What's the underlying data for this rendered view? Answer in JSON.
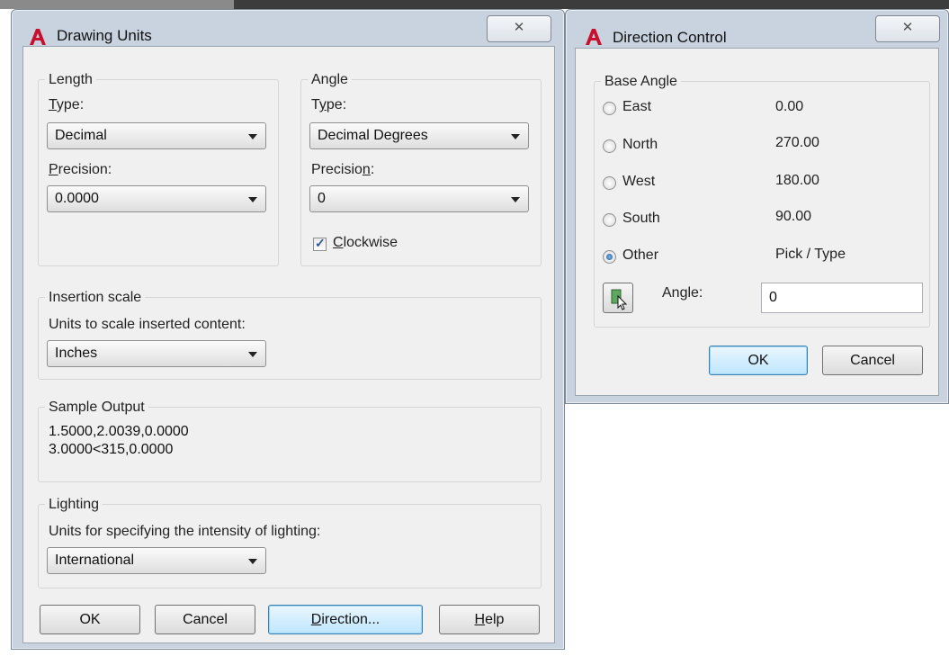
{
  "drawing_units": {
    "title": "Drawing Units",
    "close_symbol": "✕",
    "length": {
      "group_label": "Length",
      "type_label": "Type:",
      "type_value": "Decimal",
      "precision_label": "Precision:",
      "precision_value": "0.0000"
    },
    "angle": {
      "group_label": "Angle",
      "type_label": "Type:",
      "type_value": "Decimal Degrees",
      "precision_label": "Precision:",
      "precision_value": "0",
      "clockwise_label": "Clockwise",
      "clockwise_checked": true
    },
    "insertion": {
      "group_label": "Insertion scale",
      "units_label": "Units to scale inserted content:",
      "units_value": "Inches"
    },
    "sample": {
      "group_label": "Sample Output",
      "line1": "1.5000,2.0039,0.0000",
      "line2": "3.0000<315,0.0000"
    },
    "lighting": {
      "group_label": "Lighting",
      "units_label": "Units for specifying the intensity of lighting:",
      "units_value": "International"
    },
    "buttons": {
      "ok": "OK",
      "cancel": "Cancel",
      "direction": "Direction...",
      "help": "Help"
    }
  },
  "direction_control": {
    "title": "Direction Control",
    "close_symbol": "✕",
    "base_angle_label": "Base Angle",
    "options": [
      {
        "label": "East",
        "value": "0.00",
        "selected": false
      },
      {
        "label": "North",
        "value": "270.00",
        "selected": false
      },
      {
        "label": "West",
        "value": "180.00",
        "selected": false
      },
      {
        "label": "South",
        "value": "90.00",
        "selected": false
      },
      {
        "label": "Other",
        "value": "Pick / Type",
        "selected": true
      }
    ],
    "angle_label": "Angle:",
    "angle_value": "0",
    "buttons": {
      "ok": "OK",
      "cancel": "Cancel"
    }
  },
  "colors": {
    "accent_red": "#c8102e",
    "default_button_border": "#3c7fb1",
    "window_frame": "#c8d3df",
    "client_background": "#f0f0f0"
  },
  "icons": {
    "app_icon": "autocad-a-icon",
    "pick_icon": "pick-point-icon",
    "close_icon": "close-icon"
  }
}
